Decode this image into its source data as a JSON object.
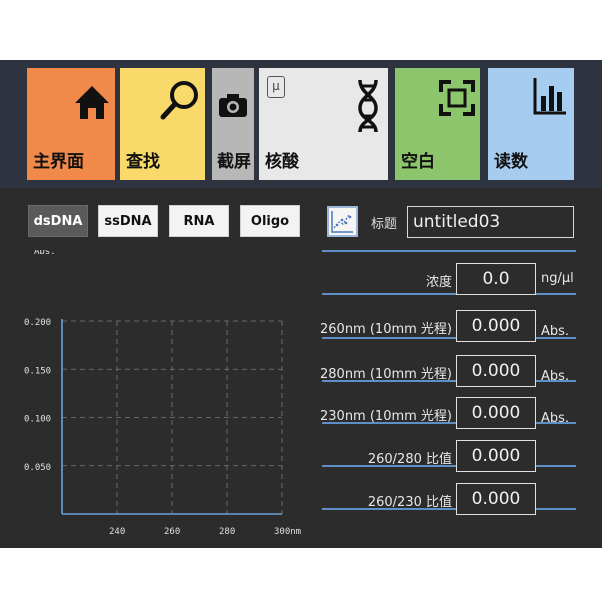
{
  "toolbar": {
    "tiles": [
      {
        "label": "主界面",
        "color": "#f0894a",
        "icon": "home-icon"
      },
      {
        "label": "查找",
        "color": "#f9d96a",
        "icon": "search-icon"
      },
      {
        "label": "截屏",
        "color": "#b7b7b7",
        "icon": "camera-icon"
      },
      {
        "label": "核酸",
        "color": "#e8e8e8",
        "icon": "dna-icon",
        "badge": "μ"
      },
      {
        "label": "空白",
        "color": "#8cc56c",
        "icon": "blank-frame-icon"
      },
      {
        "label": "读数",
        "color": "#a6cdef",
        "icon": "bar-chart-icon"
      }
    ]
  },
  "tabs": [
    {
      "label": "dsDNA",
      "active": true
    },
    {
      "label": "ssDNA",
      "active": false
    },
    {
      "label": "RNA",
      "active": false
    },
    {
      "label": "Oligo",
      "active": false
    }
  ],
  "title": {
    "label": "标题",
    "value": "untitled03"
  },
  "results": [
    {
      "label": "浓度",
      "value": "0.0",
      "unit": "ng/μl"
    },
    {
      "label": "260nm (10mm 光程)",
      "value": "0.000",
      "unit": "Abs."
    },
    {
      "label": "280nm (10mm 光程)",
      "value": "0.000",
      "unit": "Abs."
    },
    {
      "label": "230nm (10mm 光程)",
      "value": "0.000",
      "unit": "Abs."
    },
    {
      "label": "260/280 比值",
      "value": "0.000",
      "unit": ""
    },
    {
      "label": "260/230 比值",
      "value": "0.000",
      "unit": ""
    }
  ],
  "chart_data": {
    "type": "line",
    "ylabel": "Abs.",
    "xlabel": "nm",
    "x_ticks": [
      "240",
      "260",
      "280",
      "300nm"
    ],
    "y_ticks": [
      "0.200",
      "0.150",
      "0.100",
      "0.050"
    ],
    "xlim": [
      220,
      300
    ],
    "ylim": [
      0,
      0.2
    ],
    "grid": true,
    "series": []
  },
  "colors": {
    "background": "#2c2c2c",
    "toolbar": "#2e3340",
    "accent_line": "#5f8fc8",
    "axis": "#6aa0dc"
  }
}
